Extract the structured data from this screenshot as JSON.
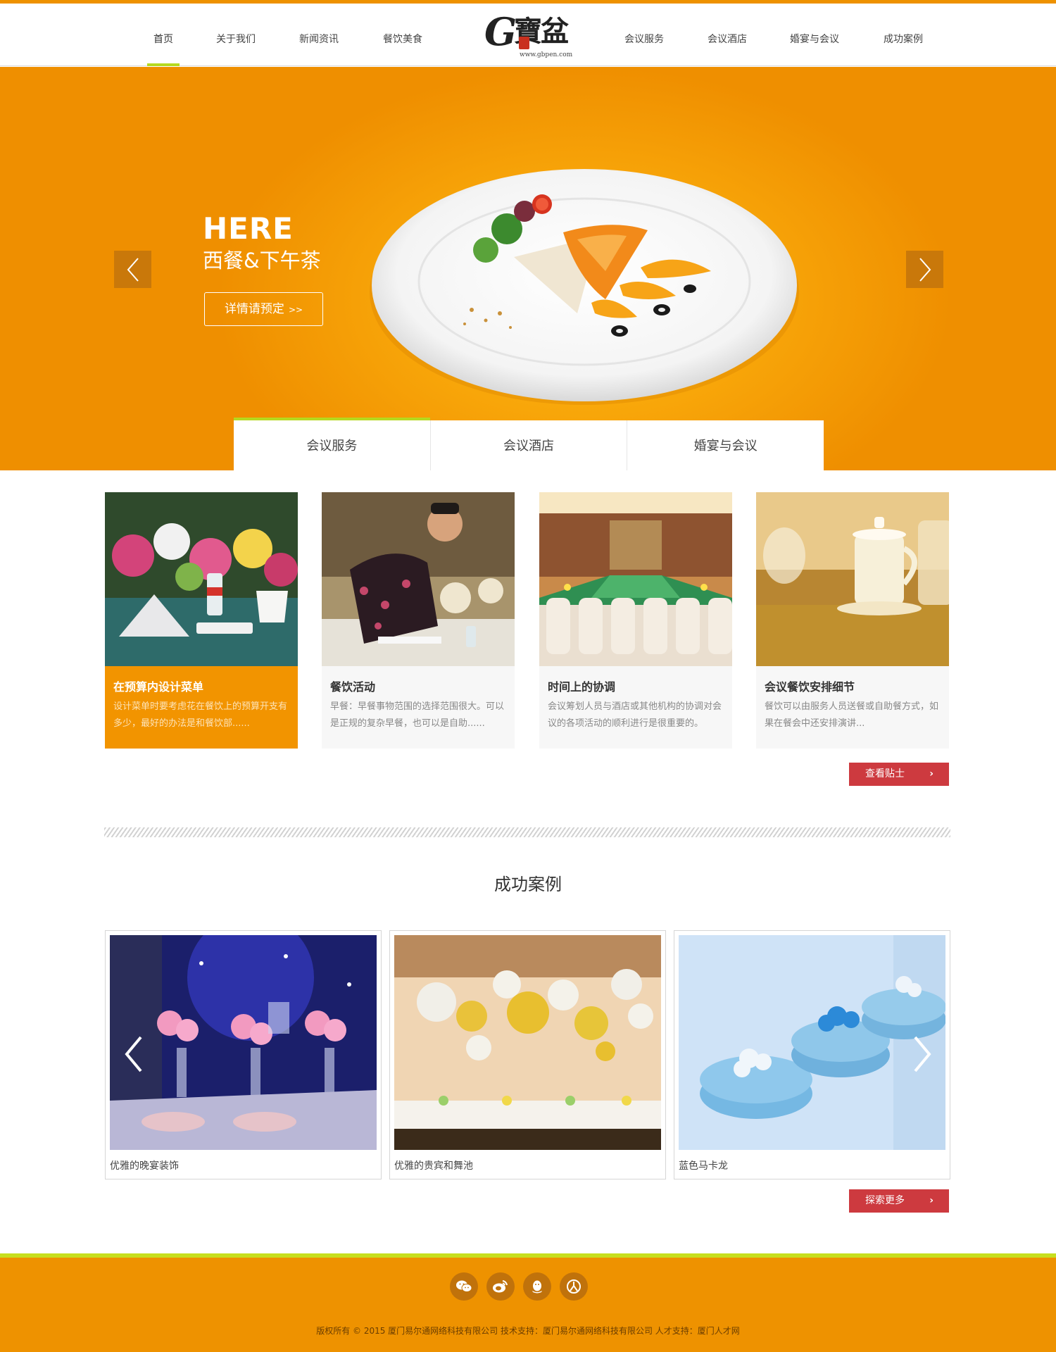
{
  "colors": {
    "brand_orange": "#ee9200",
    "accent_green": "#b5d91f",
    "button_red": "#cd3a3f"
  },
  "nav": {
    "left": [
      {
        "label": "首页",
        "active": true
      },
      {
        "label": "关于我们"
      },
      {
        "label": "新闻资讯"
      },
      {
        "label": "餐饮美食"
      }
    ],
    "right": [
      {
        "label": "会议服务"
      },
      {
        "label": "会议酒店"
      },
      {
        "label": "婚宴与会议"
      },
      {
        "label": "成功案例"
      }
    ],
    "logo": {
      "mark": "G",
      "chinese": "寶盆",
      "url": "www.gbpen.com"
    }
  },
  "banner": {
    "title": "HERE",
    "subtitle": "西餐&下午茶",
    "button": "详情请预定",
    "button_chevron": ">>",
    "prev_icon": "chevron-left-icon",
    "next_icon": "chevron-right-icon"
  },
  "service_tabs": [
    {
      "label": "会议服务",
      "active": true
    },
    {
      "label": "会议酒店"
    },
    {
      "label": "婚宴与会议"
    }
  ],
  "tips": [
    {
      "title": "在预算内设计菜单",
      "desc": "设计菜单时要考虑花在餐饮上的预算开支有多少，最好的办法是和餐饮部......",
      "active": true
    },
    {
      "title": "餐饮活动",
      "desc": "早餐：早餐事物范围的选择范围很大。可以是正规的复杂早餐，也可以是自助......"
    },
    {
      "title": "时间上的协调",
      "desc": "会议筹划人员与酒店或其他机构的协调对会议的各项活动的顺利进行是很重要的。"
    },
    {
      "title": "会议餐饮安排细节",
      "desc": "餐饮可以由服务人员送餐或自助餐方式，如果在餐会中还安排演讲..."
    }
  ],
  "tips_button": "查看贴士",
  "cases": {
    "title": "成功案例",
    "items": [
      {
        "caption": "优雅的晚宴装饰"
      },
      {
        "caption": "优雅的贵宾和舞池"
      },
      {
        "caption": "蓝色马卡龙"
      }
    ],
    "more_button": "探索更多"
  },
  "footer": {
    "social": [
      "wechat-icon",
      "weibo-icon",
      "qq-icon",
      "renren-icon"
    ],
    "copyright": "版权所有 © 2015 厦门易尔通网络科技有限公司  技术支持：厦门易尔通网络科技有限公司 人才支持：厦门人才网"
  }
}
